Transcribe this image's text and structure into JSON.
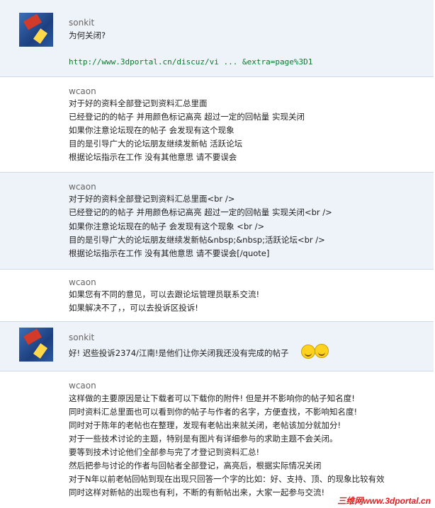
{
  "posts": [
    {
      "author": "sonkit",
      "lines": [
        "为何关闭?"
      ],
      "link": "http://www.3dportal.cn/discuz/vi ... &extra=page%3D1"
    },
    {
      "author": "wcaon",
      "lines": [
        "对于好的资料全部登记到资料汇总里面",
        "已经登记的的帖子 并用颜色标记高亮 超过一定的回帖量 实现关闭",
        "如果你注意论坛现在的帖子 会发现有这个现象",
        "目的是引导广大的论坛朋友继续发新帖  活跃论坛",
        "根据论坛指示在工作 没有其他意思 请不要误会"
      ]
    },
    {
      "author": "wcaon",
      "lines": [
        "对于好的资料全部登记到资料汇总里面<br />",
        "已经登记的的帖子 并用颜色标记高亮 超过一定的回帖量 实现关闭<br />",
        "如果你注意论坛现在的帖子 会发现有这个现象  <br />",
        "目的是引导广大的论坛朋友继续发新帖&nbsp;&nbsp;活跃论坛<br />",
        "根据论坛指示在工作 没有其他意思 请不要误会[/quote]"
      ]
    },
    {
      "author": "wcaon",
      "lines": [
        "如果您有不同的意见，可以去跟论坛管理员联系交流!",
        "如果解决不了，，可以去投诉区投诉!"
      ]
    },
    {
      "author": "sonkit",
      "lines": [
        "好! 迟些投诉2374/江南!是他们让你关闭我还没有完成的帖子"
      ]
    },
    {
      "author": "wcaon",
      "lines": [
        "这样做的主要原因是让下载者可以下载你的附件! 但是并不影响你的帖子知名度!",
        "同时资料汇总里面也可以看到你的帖子与作者的名字，方便查找，不影响知名度!",
        "同时对于陈年的老帖也在整理，发现有老帖出来就关闭，老帖该加分就加分!",
        "对于一些技术讨论的主题，特别是有图片有详细参与的求助主题不会关闭。",
        "要等到技术讨论他们全部参与完了才登记到资料汇总!",
        "然后把参与讨论的作者与回帖者全部登记，高亮后，根据实际情况关闭",
        "对于N年以前老帖回帖到现在出现只回答一个字的比如：好、支持、顶、的现象比较有效",
        "同时这样对新帖的出现也有利，不断的有新帖出来，大家一起参与交流!"
      ]
    }
  ],
  "watermark": "三维网www.3dportal.cn"
}
